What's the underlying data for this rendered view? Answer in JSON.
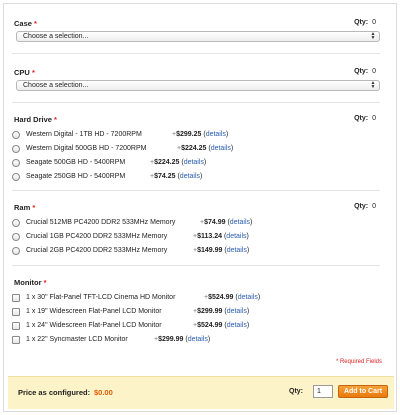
{
  "required_marker": "*",
  "qty_label": "Qty:",
  "details_label": "details",
  "sections": {
    "case": {
      "title": "Case",
      "qty": "0",
      "select_value": "Choose a selection..."
    },
    "cpu": {
      "title": "CPU",
      "qty": "0",
      "select_value": "Choose a selection..."
    },
    "hard_drive": {
      "title": "Hard Drive",
      "qty": "0",
      "options": [
        {
          "name": "Western Digital - 1TB HD - 7200RPM",
          "price": "$299.25"
        },
        {
          "name": "Western Digital 500GB HD - 7200RPM",
          "price": "$224.25"
        },
        {
          "name": "Seagate 500GB HD - 5400RPM",
          "price": "$224.25"
        },
        {
          "name": "Seagate 250GB HD - 5400RPM",
          "price": "$74.25"
        }
      ]
    },
    "ram": {
      "title": "Ram",
      "qty": "0",
      "options": [
        {
          "name": "Crucial 512MB PC4200 DDR2 533MHz Memory",
          "price": "$74.99"
        },
        {
          "name": "Crucial 1GB PC4200 DDR2 533MHz Memory",
          "price": "$113.24"
        },
        {
          "name": "Crucial 2GB PC4200 DDR2 533MHz Memory",
          "price": "$149.99"
        }
      ]
    },
    "monitor": {
      "title": "Monitor",
      "options": [
        {
          "name": "1 x 30\" Flat-Panel TFT-LCD Cinema HD Monitor",
          "price": "$524.99"
        },
        {
          "name": "1 x 19\" Widescreen Flat-Panel LCD Monitor",
          "price": "$299.99"
        },
        {
          "name": "1 x 24\" Widescreen Flat-Panel LCD Monitor",
          "price": "$524.99"
        },
        {
          "name": "1 x 22\" Syncmaster LCD Monitor",
          "price": "$299.99"
        }
      ]
    }
  },
  "required_fields_note": "* Required Fields",
  "footer": {
    "price_label": "Price as configured:",
    "price_value": "$0.00",
    "qty_label": "Qty:",
    "qty_value": "1",
    "add_to_cart_label": "Add to Cart"
  },
  "colors": {
    "required": "#dd2222",
    "link": "#2a5db0",
    "footer_bg": "#fdf3c8",
    "button": "#e87a0c",
    "price": "#e05a00"
  }
}
